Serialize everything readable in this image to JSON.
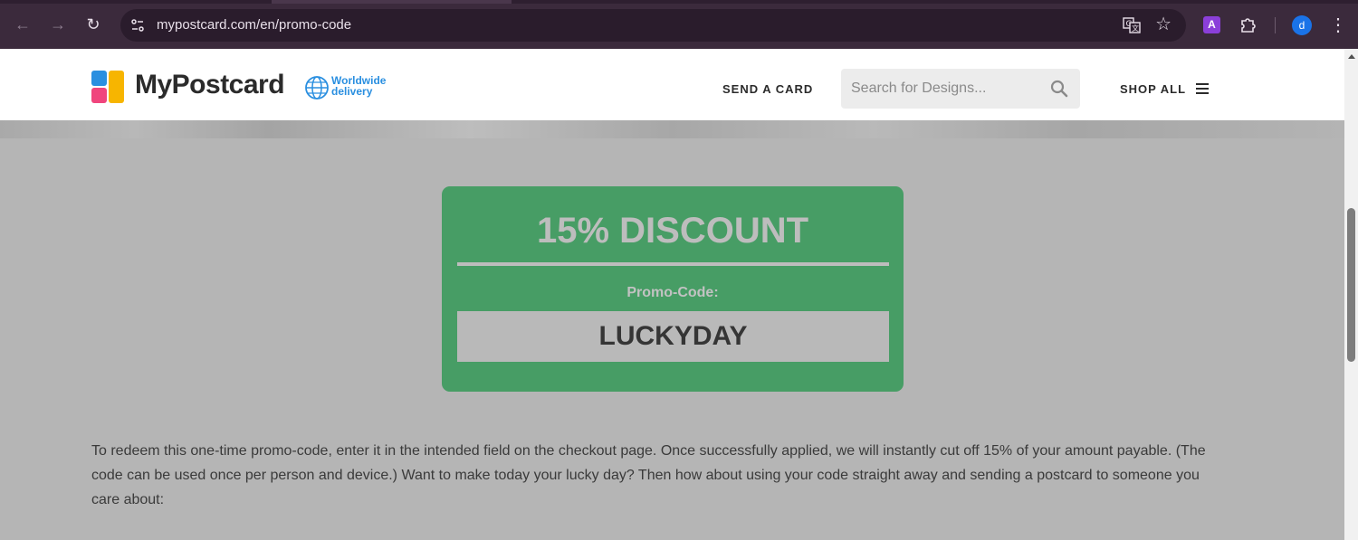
{
  "browser": {
    "url": "mypostcard.com/en/promo-code",
    "extension_label": "A",
    "profile_initial": "d"
  },
  "site": {
    "logo_text": "MyPostcard",
    "worldwide_line1": "Worldwide",
    "worldwide_line2": "delivery",
    "nav_send_card": "SEND A CARD",
    "search_placeholder": "Search for Designs...",
    "nav_shop_all": "SHOP ALL"
  },
  "promo": {
    "title": "15% DISCOUNT",
    "code_label": "Promo-Code:",
    "code": "LUCKYDAY"
  },
  "description": "To redeem this one-time promo-code, enter it in the intended field on the checkout page. Once successfully applied, we will instantly cut off 15% of your amount payable. (The code can be used once per person and device.) Want to make today your lucky day? Then how about using your code straight away and sending a postcard to someone you care about:",
  "colors": {
    "promo_green": "#479d65",
    "overlay_gray": "#b5b5b5",
    "accent_blue": "#2a8fe0"
  }
}
